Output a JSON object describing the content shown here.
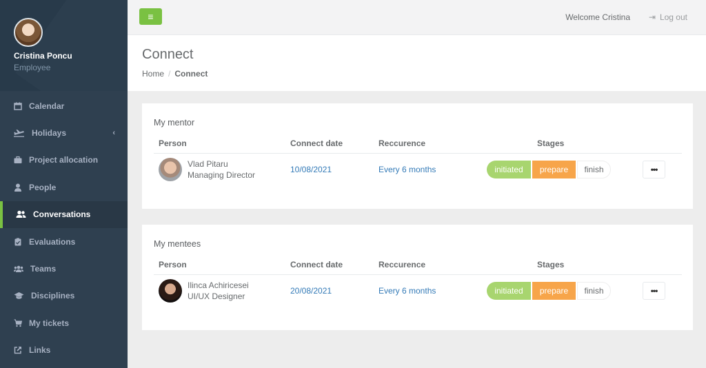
{
  "profile": {
    "name": "Cristina Poncu",
    "role": "Employee"
  },
  "sidebar": {
    "items": [
      {
        "label": "Calendar",
        "icon": "calendar-icon"
      },
      {
        "label": "Holidays",
        "icon": "plane-icon",
        "has_chevron": true
      },
      {
        "label": "Project allocation",
        "icon": "briefcase-icon"
      },
      {
        "label": "People",
        "icon": "user-icon"
      },
      {
        "label": "Conversations",
        "icon": "users-icon",
        "active": true
      },
      {
        "label": "Evaluations",
        "icon": "clipboard-icon"
      },
      {
        "label": "Teams",
        "icon": "group-icon"
      },
      {
        "label": "Disciplines",
        "icon": "graduation-cap-icon"
      },
      {
        "label": "My tickets",
        "icon": "cart-icon"
      },
      {
        "label": "Links",
        "icon": "external-link-icon"
      }
    ],
    "chevron": "‹"
  },
  "topbar": {
    "menu_icon": "≡",
    "welcome": "Welcome Cristina",
    "logout_icon": "⇥",
    "logout": "Log out"
  },
  "heading": {
    "title": "Connect",
    "breadcrumb": {
      "home": "Home",
      "separator": "/",
      "current": "Connect"
    }
  },
  "table_headers": {
    "person": "Person",
    "connect_date": "Connect date",
    "recurrence": "Reccurence",
    "stages": "Stages"
  },
  "stage_labels": {
    "initiated": "initiated",
    "prepare": "prepare",
    "finish": "finish"
  },
  "more_label": "•••",
  "mentor": {
    "title": "My mentor",
    "row": {
      "name": "Vlad Pitaru",
      "position": "Managing Director",
      "date": "10/08/2021",
      "recurrence": "Every 6 months"
    }
  },
  "mentees": {
    "title": "My mentees",
    "row": {
      "name": "Ilinca Achiricesei",
      "position": "UI/UX Designer",
      "date": "20/08/2021",
      "recurrence": "Every 6 months"
    }
  },
  "colors": {
    "sidebar": "#2f4050",
    "accent": "#7ac142",
    "initiated": "#a8d56f",
    "prepare": "#f7a54a",
    "link": "#337ab7"
  }
}
